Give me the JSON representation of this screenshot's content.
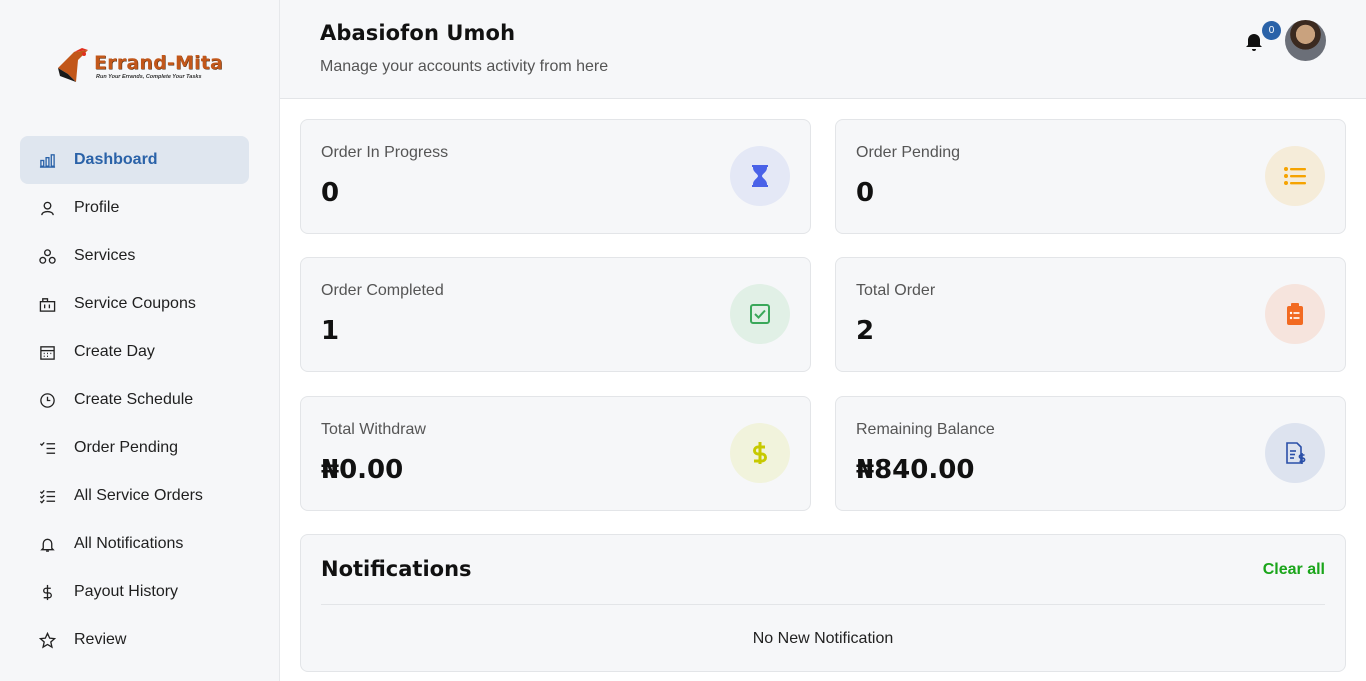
{
  "brand": {
    "name": "Errand-Mita",
    "tagline": "Run Your Errands, Complete Your Tasks"
  },
  "sidebar": {
    "items": [
      {
        "label": "Dashboard",
        "icon": "bar-chart-icon",
        "active": true
      },
      {
        "label": "Profile",
        "icon": "user-icon"
      },
      {
        "label": "Services",
        "icon": "services-icon"
      },
      {
        "label": "Service Coupons",
        "icon": "coupon-icon"
      },
      {
        "label": "Create Day",
        "icon": "calendar-icon"
      },
      {
        "label": "Create Schedule",
        "icon": "clock-icon"
      },
      {
        "label": "Order Pending",
        "icon": "list-check-icon"
      },
      {
        "label": "All Service Orders",
        "icon": "checklist-icon"
      },
      {
        "label": "All Notifications",
        "icon": "bell-icon"
      },
      {
        "label": "Payout History",
        "icon": "dollar-icon"
      },
      {
        "label": "Review",
        "icon": "star-icon"
      }
    ]
  },
  "header": {
    "user_name": "Abasiofon Umoh",
    "subtitle": "Manage your accounts activity from here",
    "notification_count": "0"
  },
  "cards": [
    {
      "title": "Order In Progress",
      "value": "0",
      "icon": "hourglass-icon",
      "color": "#4a62e8",
      "bg": "#e4e8f6"
    },
    {
      "title": "Order Pending",
      "value": "0",
      "icon": "list-icon",
      "color": "#f5a300",
      "bg": "#f5ecd9"
    },
    {
      "title": "Order Completed",
      "value": "1",
      "icon": "check-square-icon",
      "color": "#3aa85a",
      "bg": "#e1f0e6"
    },
    {
      "title": "Total Order",
      "value": "2",
      "icon": "clipboard-icon",
      "color": "#f26a21",
      "bg": "#f6e4dd"
    },
    {
      "title": "Total Withdraw",
      "value": "₦0.00",
      "icon": "dollar-icon",
      "color": "#c7c900",
      "bg": "#f1f3dc"
    },
    {
      "title": "Remaining Balance",
      "value": "₦840.00",
      "icon": "invoice-dollar-icon",
      "color": "#2a4fa8",
      "bg": "#dde3ef"
    }
  ],
  "notifications": {
    "title": "Notifications",
    "clear_label": "Clear all",
    "empty_text": "No New Notification"
  }
}
